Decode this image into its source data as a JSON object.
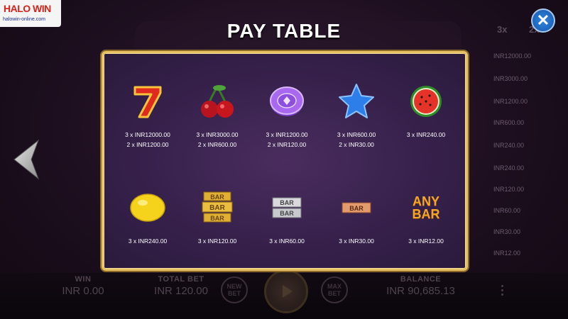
{
  "logo": {
    "line1": "HALO WIN",
    "line2": "halowin-online.com"
  },
  "title": "PAY TABLE",
  "paytable": {
    "row1": [
      {
        "symbol": "seven-icon",
        "pays": [
          "3 x INR12000.00",
          "2 x INR1200.00"
        ]
      },
      {
        "symbol": "cherry-icon",
        "pays": [
          "3 x INR3000.00",
          "2 x INR600.00"
        ]
      },
      {
        "symbol": "chip-icon",
        "pays": [
          "3 x INR1200.00",
          "2 x INR120.00"
        ]
      },
      {
        "symbol": "star-icon",
        "pays": [
          "3 x INR600.00",
          "2 x INR30.00"
        ]
      },
      {
        "symbol": "watermelon-icon",
        "pays": [
          "3 x INR240.00"
        ]
      }
    ],
    "row2": [
      {
        "symbol": "lemon-icon",
        "pays": [
          "3 x INR240.00"
        ]
      },
      {
        "symbol": "gold-bar-icon",
        "pays": [
          "3 x INR120.00"
        ]
      },
      {
        "symbol": "silver-bar-icon",
        "pays": [
          "3 x INR60.00"
        ]
      },
      {
        "symbol": "bronze-bar-icon",
        "pays": [
          "3 x INR30.00"
        ]
      },
      {
        "symbol": "any-bar-icon",
        "label": "ANY BAR",
        "pays": [
          "3 x INR12.00"
        ]
      }
    ]
  },
  "bottom": {
    "win_label": "WIN",
    "win_value": "INR 0.00",
    "total_bet_label": "TOTAL BET",
    "total_bet_value": "INR 120.00",
    "new_bet": "NEW BET",
    "max_bet": "MAX BET",
    "balance_label": "BALANCE",
    "balance_value": "INR 90,685.13"
  },
  "side_paytable": {
    "headers": [
      "3x",
      "2x"
    ],
    "rows": [
      "INR12000.00",
      "INR3000.00",
      "INR1200.00",
      "INR600.00",
      "INR240.00",
      "INR240.00",
      "INR120.00",
      "INR60.00",
      "INR30.00",
      "INR12.00"
    ]
  },
  "colors": {
    "frame": "#e8c262",
    "panel": "#3a2450",
    "accent_blue": "#1f6fd0"
  }
}
